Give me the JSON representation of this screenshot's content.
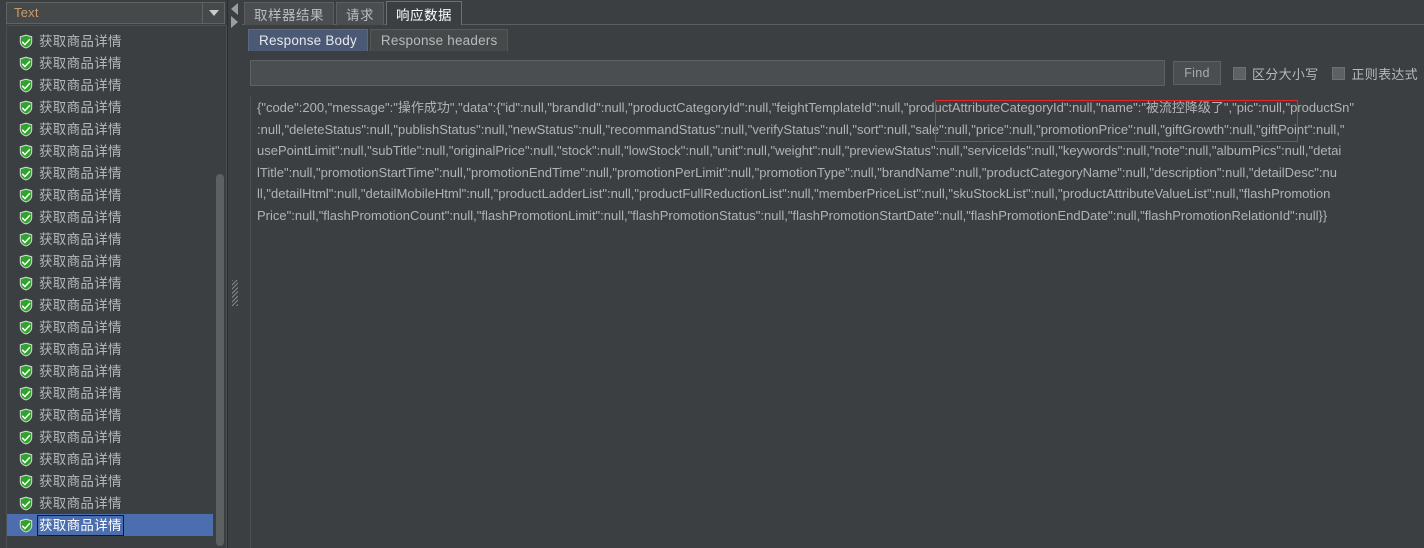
{
  "left_panel": {
    "view_selector": {
      "value": "Text",
      "icon": "chevron-down-icon"
    },
    "tree_items": [
      {
        "label": "获取商品详情",
        "status": "success",
        "selected": false
      },
      {
        "label": "获取商品详情",
        "status": "success",
        "selected": false
      },
      {
        "label": "获取商品详情",
        "status": "success",
        "selected": false
      },
      {
        "label": "获取商品详情",
        "status": "success",
        "selected": false
      },
      {
        "label": "获取商品详情",
        "status": "success",
        "selected": false
      },
      {
        "label": "获取商品详情",
        "status": "success",
        "selected": false
      },
      {
        "label": "获取商品详情",
        "status": "success",
        "selected": false
      },
      {
        "label": "获取商品详情",
        "status": "success",
        "selected": false
      },
      {
        "label": "获取商品详情",
        "status": "success",
        "selected": false
      },
      {
        "label": "获取商品详情",
        "status": "success",
        "selected": false
      },
      {
        "label": "获取商品详情",
        "status": "success",
        "selected": false
      },
      {
        "label": "获取商品详情",
        "status": "success",
        "selected": false
      },
      {
        "label": "获取商品详情",
        "status": "success",
        "selected": false
      },
      {
        "label": "获取商品详情",
        "status": "success",
        "selected": false
      },
      {
        "label": "获取商品详情",
        "status": "success",
        "selected": false
      },
      {
        "label": "获取商品详情",
        "status": "success",
        "selected": false
      },
      {
        "label": "获取商品详情",
        "status": "success",
        "selected": false
      },
      {
        "label": "获取商品详情",
        "status": "success",
        "selected": false
      },
      {
        "label": "获取商品详情",
        "status": "success",
        "selected": false
      },
      {
        "label": "获取商品详情",
        "status": "success",
        "selected": false
      },
      {
        "label": "获取商品详情",
        "status": "success",
        "selected": false
      },
      {
        "label": "获取商品详情",
        "status": "success",
        "selected": false
      },
      {
        "label": "获取商品详情",
        "status": "success",
        "selected": true
      }
    ]
  },
  "splitter": {
    "collapse_left_icon": "triangle-left-icon",
    "collapse_right_icon": "triangle-right-icon",
    "grip_icon": "splitter-grip-icon"
  },
  "right_panel": {
    "tabs": [
      {
        "label": "取样器结果",
        "active": false
      },
      {
        "label": "请求",
        "active": false
      },
      {
        "label": "响应数据",
        "active": true
      }
    ],
    "subtabs": [
      {
        "label": "Response Body",
        "active": true
      },
      {
        "label": "Response headers",
        "active": false
      }
    ],
    "search": {
      "value": "",
      "placeholder": "",
      "find_button": "Find",
      "case_sensitive_label": "区分大小写",
      "case_sensitive_checked": false,
      "regex_label": "正则表达式",
      "regex_checked": false
    },
    "response_body": {
      "lines": [
        "{\"code\":200,\"message\":\"操作成功\",\"data\":{\"id\":null,\"brandId\":null,\"productCategoryId\":null,\"feightTemplateId\":null,\"productAttributeCategoryId\":null,\"name\":\"被流控降级了\",\"pic\":null,\"productSn\"",
        ":null,\"deleteStatus\":null,\"publishStatus\":null,\"newStatus\":null,\"recommandStatus\":null,\"verifyStatus\":null,\"sort\":null,\"sale\":null,\"price\":null,\"promotionPrice\":null,\"giftGrowth\":null,\"giftPoint\":null,\"",
        "usePointLimit\":null,\"subTitle\":null,\"originalPrice\":null,\"stock\":null,\"lowStock\":null,\"unit\":null,\"weight\":null,\"previewStatus\":null,\"serviceIds\":null,\"keywords\":null,\"note\":null,\"albumPics\":null,\"detai",
        "lTitle\":null,\"promotionStartTime\":null,\"promotionEndTime\":null,\"promotionPerLimit\":null,\"promotionType\":null,\"brandName\":null,\"productCategoryName\":null,\"description\":null,\"detailDesc\":nu",
        "ll,\"detailHtml\":null,\"detailMobileHtml\":null,\"productLadderList\":null,\"productFullReductionList\":null,\"memberPriceList\":null,\"skuStockList\":null,\"productAttributeValueList\":null,\"flashPromotion",
        "Price\":null,\"flashPromotionCount\":null,\"flashPromotionLimit\":null,\"flashPromotionStatus\":null,\"flashPromotionStartDate\":null,\"flashPromotionEndDate\":null,\"flashPromotionRelationId\":null}}"
      ],
      "highlight": {
        "note": "red annotation rectangle around productAttributeCategoryId..name value",
        "color": "#e02a2a"
      }
    }
  },
  "colors": {
    "window_bg": "#3c3f41",
    "selection_blue": "#4b6eaf",
    "accent_orange": "#cc9a68",
    "success_green": "#33a632",
    "highlight_red": "#e02a2a"
  }
}
